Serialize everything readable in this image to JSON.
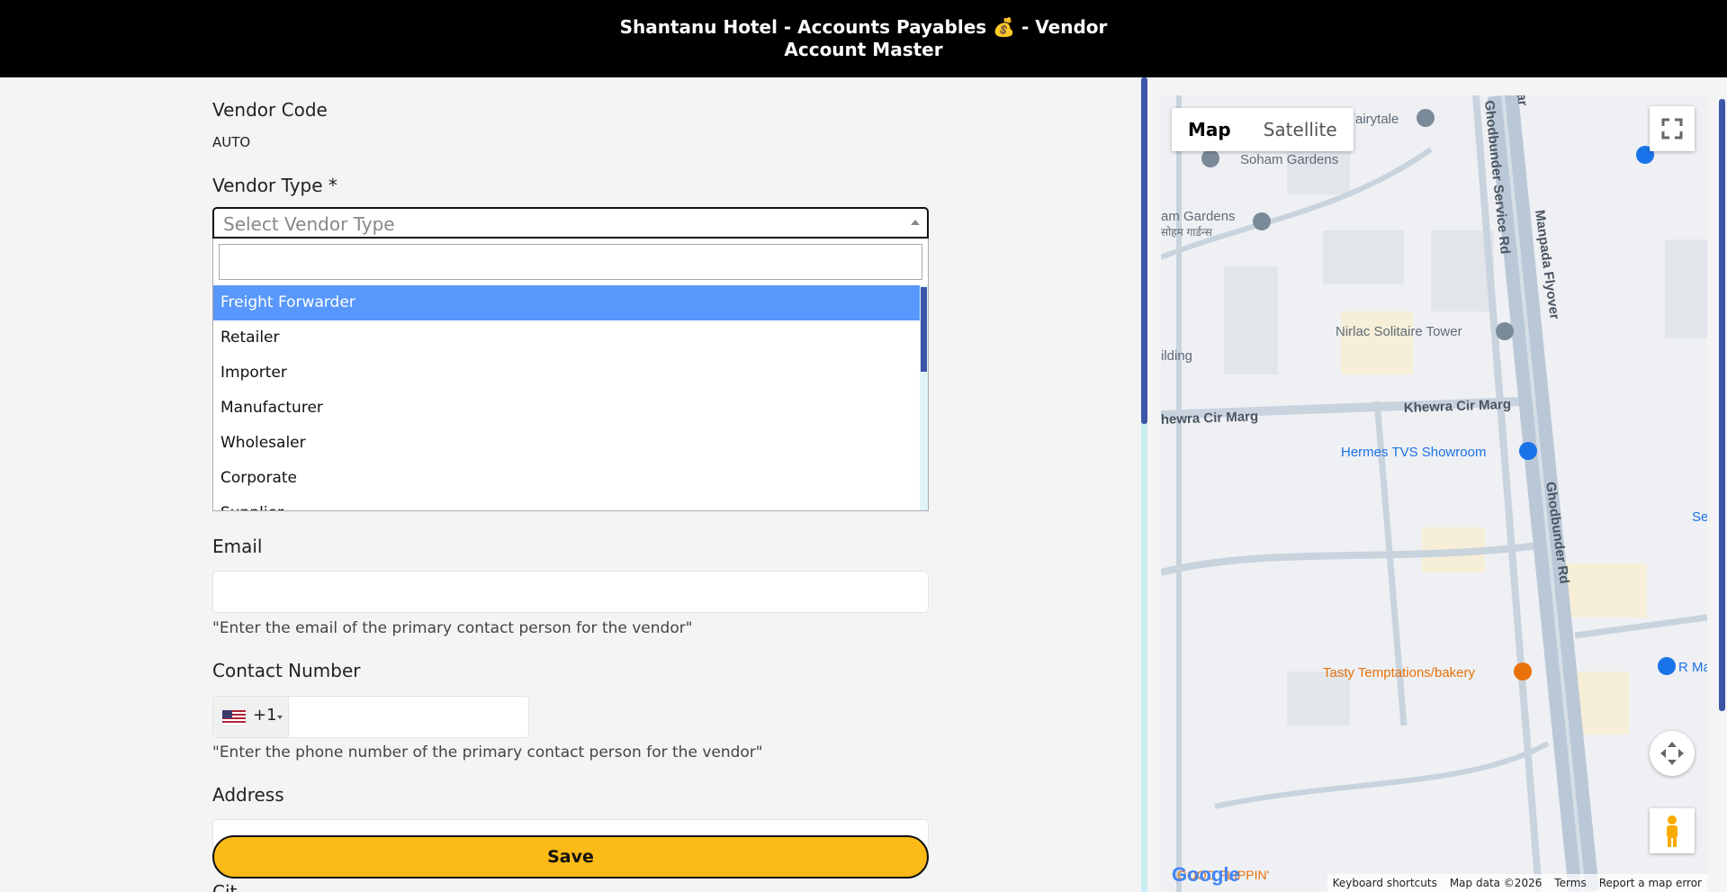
{
  "header": {
    "title": "Shantanu Hotel - Accounts Payables 💰 - Vendor Account Master"
  },
  "form": {
    "vendor_code": {
      "label": "Vendor Code",
      "value": "AUTO"
    },
    "vendor_type": {
      "label": "Vendor Type *",
      "placeholder": "Select Vendor Type",
      "search_value": "",
      "options": [
        "Freight Forwarder",
        "Retailer",
        "Importer",
        "Manufacturer",
        "Wholesaler",
        "Corporate",
        "Supplier"
      ],
      "highlighted": "Freight Forwarder"
    },
    "email": {
      "label": "Email",
      "value": "",
      "hint": "\"Enter the email of the primary contact person for the vendor\""
    },
    "contact_number": {
      "label": "Contact Number",
      "dial_code": "+1",
      "value": "",
      "hint": "\"Enter the phone number of the primary contact person for the vendor\""
    },
    "address": {
      "label": "Address",
      "value": ""
    },
    "next_label_partial": "Cit",
    "save_label": "Save"
  },
  "map": {
    "tabs": [
      "Map",
      "Satellite"
    ],
    "active_tab": "Map",
    "places": [
      "Soham Gardens",
      "am Gardens",
      "सोहम गार्डन्स",
      "airytale",
      "Nirlac Solitaire Tower",
      "ilding",
      "Hermes TVS Showroom",
      "Tasty Temptations/bakery",
      "R Ma",
      "Se",
      "GOOD FLIPPIN'"
    ],
    "roads": [
      "Ghodbunder Service Rd",
      "Manpada Flyover",
      "Khewra Cir Marg",
      "hewra Cir Marg",
      "Ghodbunder Rd",
      "ar"
    ],
    "footer": [
      "Keyboard shortcuts",
      "Map data ©2026",
      "Terms",
      "Report a map error"
    ],
    "logo": "Google",
    "colors": {
      "road": "#c9d3de",
      "highway": "#b9c7d6",
      "building": "#e2e5ea",
      "poi_blue": "#1a73e8",
      "poi_orange": "#e8710a"
    }
  }
}
